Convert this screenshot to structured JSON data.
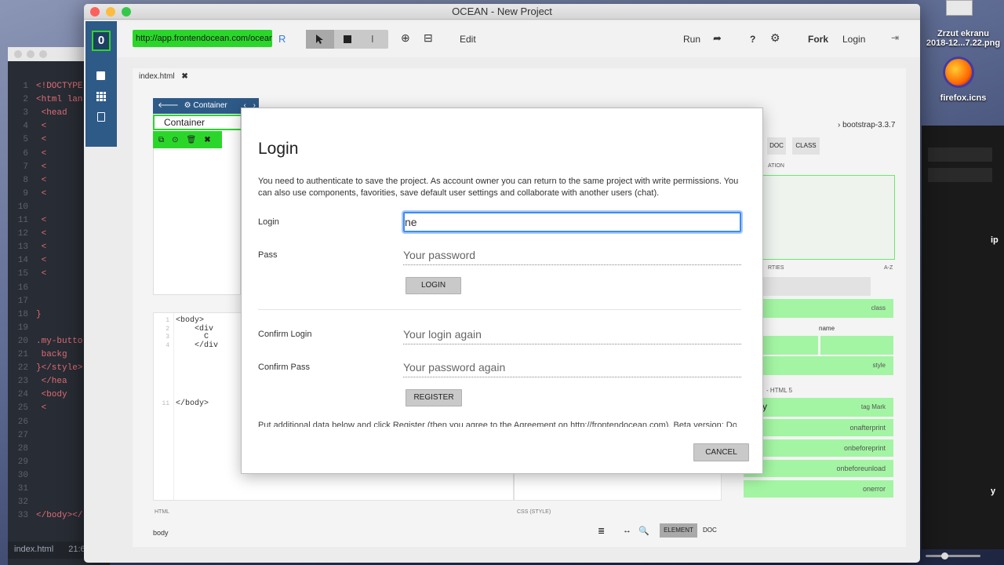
{
  "app": {
    "title": "OCEAN - New Project"
  },
  "toolbar": {
    "url": "http://app.frontendocean.com/ocean",
    "reload_label": "R",
    "edit_label": "Edit",
    "run_label": "Run",
    "help_label": "?",
    "fork_label": "Fork",
    "login_label": "Login"
  },
  "editor": {
    "tab_label": "index.html",
    "breadcrumb_label": "Container",
    "selected_element_label": "Container",
    "code_lines": [
      {
        "n": "1",
        "text": "<body>"
      },
      {
        "n": "2",
        "text": "    <div"
      },
      {
        "n": "3",
        "text": "      C"
      },
      {
        "n": "4",
        "text": "    </div"
      },
      {
        "n": "11",
        "text": "</body>"
      }
    ],
    "html_pane_label": "HTML",
    "css_pane_label": "CSS (STYLE)",
    "path_label": "body",
    "element_tab": "ELEMENT",
    "doc_tab": "DOC"
  },
  "props": {
    "library": "› bootstrap-3.3.7",
    "tabs": [
      "DOC",
      "CLASS"
    ],
    "section_label": "ATION",
    "properties_label": "RTIES",
    "sort_label": "A-Z",
    "class_label": "class",
    "name_label": "name",
    "style_label": "style",
    "html5_label": "- HTML 5",
    "body_value": "y",
    "tag_mark": "tag Mark",
    "events": [
      "onafterprint",
      "onbeforeprint",
      "onbeforeunload",
      "onerror"
    ]
  },
  "modal": {
    "title": "Login",
    "description": "You need to authenticate to save the project. As account owner you can return to the same project with write permissions. You can also use components, favorities, save default user settings and collaborate with another users (chat).",
    "login_label": "Login",
    "login_value": "ne",
    "pass_label": "Pass",
    "pass_placeholder": "Your password",
    "login_button": "LOGIN",
    "confirm_login_label": "Confirm Login",
    "confirm_login_placeholder": "Your login again",
    "confirm_pass_label": "Confirm Pass",
    "confirm_pass_placeholder": "Your password again",
    "register_button": "REGISTER",
    "agreement_text": "Put additional data below and click Register (then you agree to the Agreement on http://frontendocean.com). Beta version: Do",
    "cancel_button": "CANCEL"
  },
  "background_editor": {
    "lines": [
      {
        "n": "1",
        "text": "<!DOCTYPE"
      },
      {
        "n": "2",
        "text": "<html lan"
      },
      {
        "n": "3",
        "text": "    <head"
      },
      {
        "n": "4",
        "text": "      <"
      },
      {
        "n": "5",
        "text": "      <"
      },
      {
        "n": "6",
        "text": "      <"
      },
      {
        "n": "7",
        "text": "      <"
      },
      {
        "n": "8",
        "text": "      <"
      },
      {
        "n": "9",
        "text": "      <"
      },
      {
        "n": "10",
        "text": ""
      },
      {
        "n": "11",
        "text": "      <"
      },
      {
        "n": "12",
        "text": "      <"
      },
      {
        "n": "13",
        "text": "      <"
      },
      {
        "n": "14",
        "text": "      <"
      },
      {
        "n": "15",
        "text": "      <"
      },
      {
        "n": "16",
        "text": ""
      },
      {
        "n": "17",
        "text": ""
      },
      {
        "n": "18",
        "text": "}"
      },
      {
        "n": "19",
        "text": ""
      },
      {
        "n": "20",
        "text": ".my-butto"
      },
      {
        "n": "21",
        "text": "    backg"
      },
      {
        "n": "22",
        "text": "}</style>"
      },
      {
        "n": "23",
        "text": "    </hea"
      },
      {
        "n": "24",
        "text": "    <body"
      },
      {
        "n": "25",
        "text": "      <"
      },
      {
        "n": "26",
        "text": ""
      },
      {
        "n": "27",
        "text": ""
      },
      {
        "n": "28",
        "text": ""
      },
      {
        "n": "29",
        "text": ""
      },
      {
        "n": "30",
        "text": ""
      },
      {
        "n": "31",
        "text": ""
      },
      {
        "n": "32",
        "text": ""
      },
      {
        "n": "33",
        "text": "</body></"
      }
    ],
    "status_file": "index.html",
    "status_pos": "21:6"
  },
  "desktop": {
    "screenshot_label_1": "Zrzut ekranu",
    "screenshot_label_2": "2018-12...7.22.png",
    "firefox_label": "firefox.icns",
    "partial_label_1": "ip",
    "partial_label_2": "y"
  }
}
